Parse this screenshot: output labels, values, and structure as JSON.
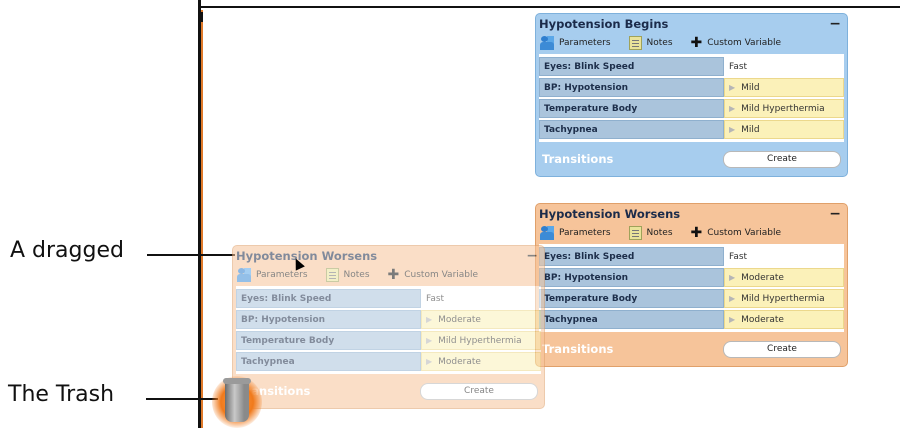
{
  "callouts": {
    "dragged": "A dragged",
    "trash": "The Trash"
  },
  "states": {
    "begins": {
      "title": "Hypotension Begins",
      "collapse": "−",
      "toolbar": {
        "parameters": "Parameters",
        "notes": "Notes",
        "custom": "Custom Variable"
      },
      "rows": [
        {
          "name": "Eyes: Blink Speed",
          "value": "Fast"
        },
        {
          "name": "BP: Hypotension",
          "value": "Mild"
        },
        {
          "name": "Temperature Body",
          "value": "Mild Hyperthermia"
        },
        {
          "name": "Tachypnea",
          "value": "Mild"
        }
      ],
      "transitions": "Transitions",
      "create": "Create"
    },
    "worsens": {
      "title": "Hypotension Worsens",
      "collapse": "−",
      "toolbar": {
        "parameters": "Parameters",
        "notes": "Notes",
        "custom": "Custom Variable"
      },
      "rows": [
        {
          "name": "Eyes: Blink Speed",
          "value": "Fast"
        },
        {
          "name": "BP: Hypotension",
          "value": "Moderate"
        },
        {
          "name": "Temperature Body",
          "value": "Mild Hyperthermia"
        },
        {
          "name": "Tachypnea",
          "value": "Moderate"
        }
      ],
      "transitions": "Transitions",
      "create": "Create"
    },
    "dragged": {
      "title": "Hypotension Worsens",
      "collapse": "−",
      "toolbar": {
        "parameters": "Parameters",
        "notes": "Notes",
        "custom": "Custom Variable"
      },
      "rows": [
        {
          "name": "Eyes: Blink Speed",
          "value": "Fast"
        },
        {
          "name": "BP: Hypotension",
          "value": "Moderate"
        },
        {
          "name": "Temperature Body",
          "value": "Mild Hyperthermia"
        },
        {
          "name": "Tachypnea",
          "value": "Moderate"
        }
      ],
      "transitions": "Transitions",
      "create": "Create"
    }
  },
  "colors": {
    "blue_state": "#a7cdee",
    "orange_state": "#f6c49a",
    "value_highlight": "#fbf1b9",
    "trash_glow": "#f07a1c"
  },
  "icons": {
    "parameters": "person-icon",
    "notes": "notes-icon",
    "custom": "plus-icon",
    "trash": "trash-can-icon"
  }
}
